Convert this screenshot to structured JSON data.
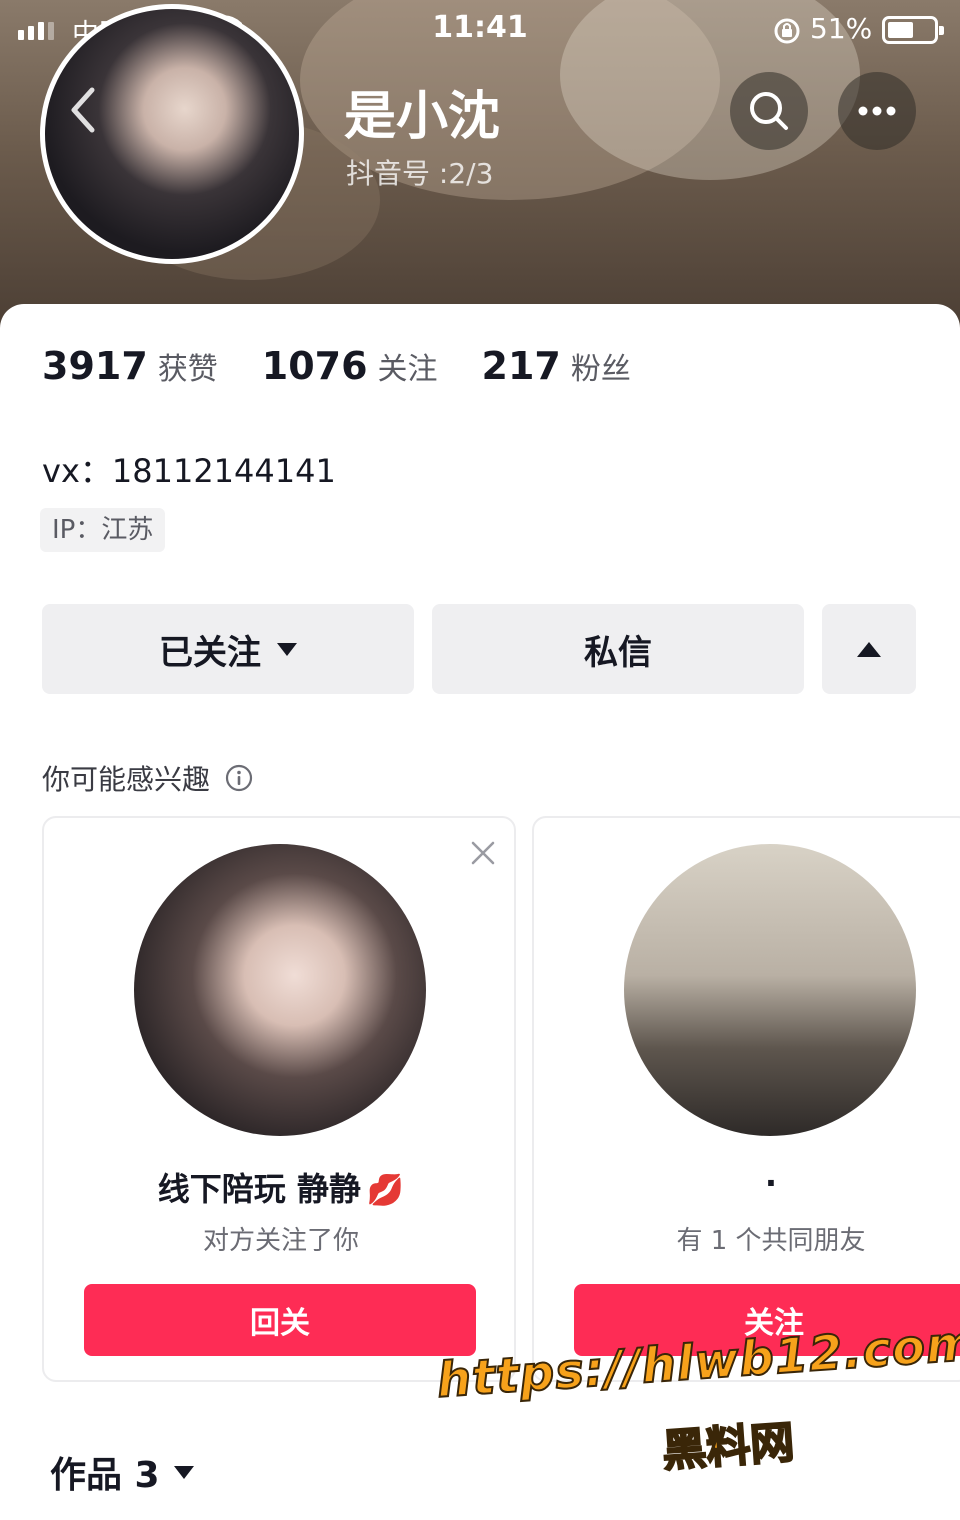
{
  "status_bar": {
    "carrier": "中国联通",
    "time": "11:41",
    "battery": "51%",
    "battery_level": 0.51,
    "icons": [
      "signal-icon",
      "wifi-icon",
      "orientation-lock-icon",
      "battery-icon"
    ]
  },
  "profile": {
    "nickname": "是小沈",
    "douyin_id": "抖音号 :2/3",
    "stats": [
      {
        "value": "3917",
        "label": "获赞"
      },
      {
        "value": "1076",
        "label": "关注"
      },
      {
        "value": "217",
        "label": "粉丝"
      }
    ],
    "bio": "vx：18112144141",
    "ip": "IP：江苏"
  },
  "actions": {
    "followed": "已关注",
    "message": "私信"
  },
  "suggestions": {
    "title": "你可能感兴趣",
    "cards": [
      {
        "name": "线下陪玩 静静",
        "emoji": "💋",
        "subtitle": "对方关注了你",
        "button": "回关"
      },
      {
        "name": "·",
        "subtitle": "有 1 个共同朋友",
        "button": "关注"
      }
    ]
  },
  "tabs": {
    "works": "作品 3"
  },
  "watermark": {
    "url": "https://hlwb12.com",
    "name": "黑料网"
  },
  "colors": {
    "accent": "#fe2c55",
    "watermark": "#f7a21b"
  }
}
